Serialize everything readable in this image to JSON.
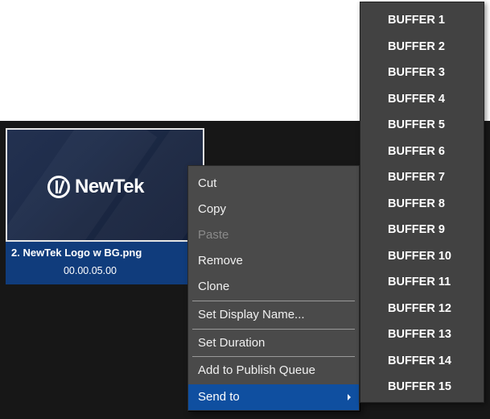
{
  "clip": {
    "name": "2. NewTek Logo w BG.png",
    "duration": "00.00.05.00",
    "logo_text": "NewTek"
  },
  "context_menu": {
    "items": [
      {
        "label": "Cut",
        "enabled": true
      },
      {
        "label": "Copy",
        "enabled": true
      },
      {
        "label": "Paste",
        "enabled": false
      },
      {
        "label": "Remove",
        "enabled": true
      },
      {
        "label": "Clone",
        "enabled": true
      },
      {
        "label": "Set Display Name...",
        "enabled": true
      },
      {
        "label": "Set Duration",
        "enabled": true
      },
      {
        "label": "Add to Publish Queue",
        "enabled": true
      },
      {
        "label": "Send to",
        "enabled": true,
        "selected": true,
        "has_submenu": true
      }
    ]
  },
  "send_to_submenu": {
    "items": [
      "BUFFER 1",
      "BUFFER 2",
      "BUFFER 3",
      "BUFFER 4",
      "BUFFER 5",
      "BUFFER 6",
      "BUFFER 7",
      "BUFFER 8",
      "BUFFER 9",
      "BUFFER 10",
      "BUFFER 11",
      "BUFFER 12",
      "BUFFER 13",
      "BUFFER 14",
      "BUFFER 15"
    ]
  },
  "colors": {
    "panel_bg": "#171717",
    "menu_bg": "#4a4a4a",
    "submenu_bg": "#424242",
    "selection": "#0f4fa0",
    "caption_bg": "#103c7c"
  }
}
